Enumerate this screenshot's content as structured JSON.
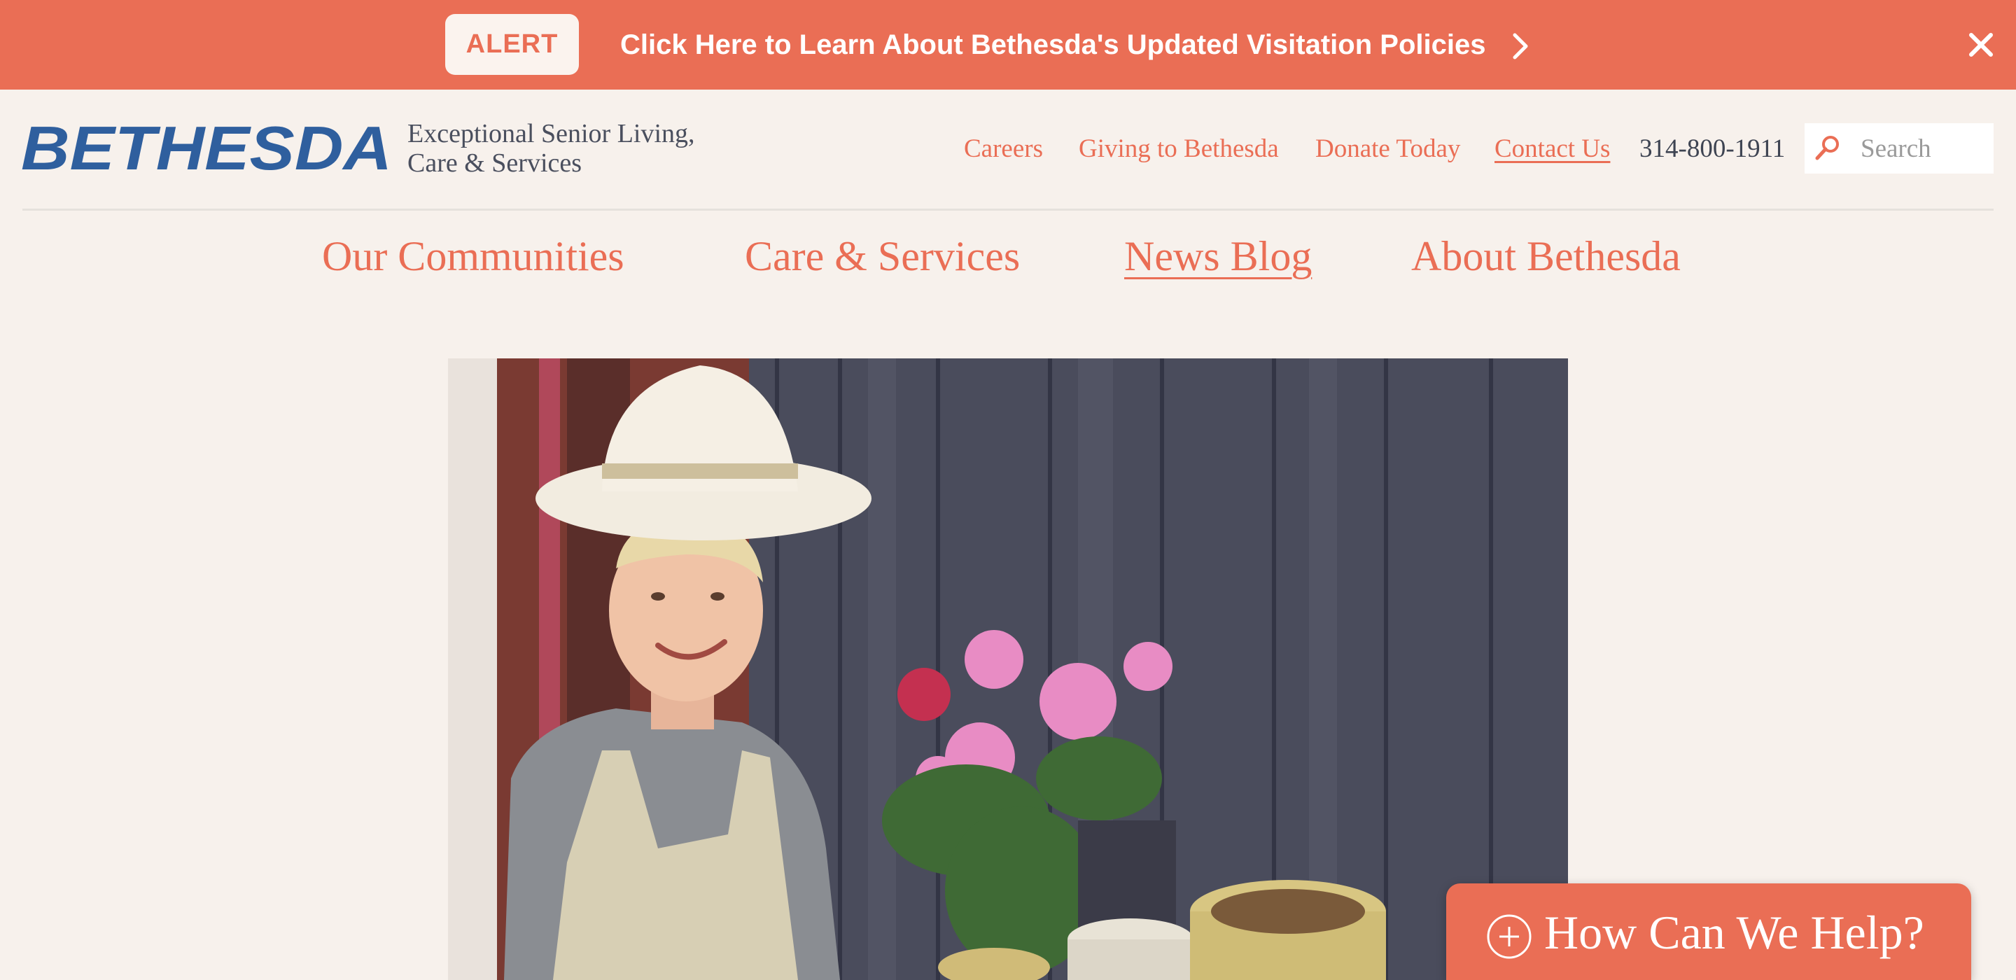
{
  "alert": {
    "badge": "ALERT",
    "message": "Click Here to Learn About Bethesda's Updated Visitation Policies",
    "chevron_icon": "chevron-right-icon",
    "close_icon": "close-icon"
  },
  "header": {
    "logo_text": "BETHESDA",
    "tagline_line1": "Exceptional Senior Living,",
    "tagline_line2": "Care & Services",
    "utility_links": [
      "Careers",
      "Giving to Bethesda",
      "Donate Today",
      "Contact Us"
    ],
    "phone": "314-800-1911",
    "search_placeholder": "Search",
    "search_icon": "search-icon"
  },
  "main_nav": [
    "Our Communities",
    "Care & Services",
    "News Blog",
    "About Bethesda"
  ],
  "hero": {
    "image": "photo of smiling senior woman in sun hat and apron gardening with potted flowers"
  },
  "help": {
    "label": "How Can We Help?",
    "icon": "plus-circle-icon"
  },
  "colors": {
    "accent": "#ea6e55",
    "background": "#f7f1ec",
    "logo_blue": "#2f5f9e",
    "text_dark": "#4a4f5e"
  }
}
